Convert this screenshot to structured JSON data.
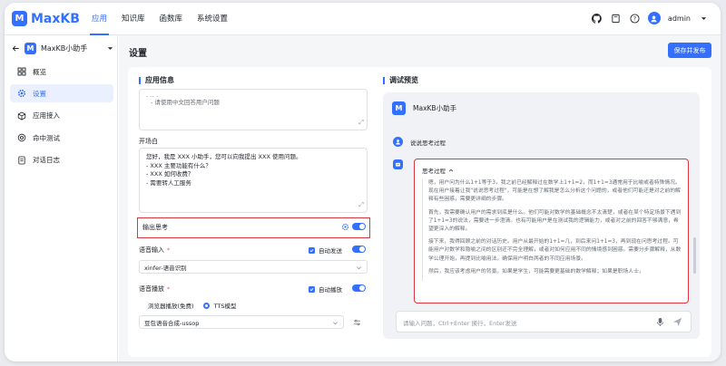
{
  "app": {
    "logo_mark": "M",
    "logo_text": "MaxKB"
  },
  "nav": [
    {
      "label": "应用",
      "active": true
    },
    {
      "label": "知识库",
      "active": false
    },
    {
      "label": "函数库",
      "active": false
    },
    {
      "label": "系统设置",
      "active": false
    }
  ],
  "user": {
    "name": "admin"
  },
  "sidebar": {
    "app_badge": "M",
    "app_name": "MaxKB小助手",
    "items": [
      {
        "label": "概览",
        "icon": "grid-icon",
        "active": false
      },
      {
        "label": "设置",
        "icon": "gear-icon",
        "active": true
      },
      {
        "label": "应用接入",
        "icon": "cube-icon",
        "active": false
      },
      {
        "label": "命中测试",
        "icon": "target-icon",
        "active": false
      },
      {
        "label": "对话日志",
        "icon": "document-icon",
        "active": false
      }
    ]
  },
  "header": {
    "title": "设置",
    "publish_label": "保存并发布"
  },
  "app_info": {
    "section_title": "应用信息",
    "prompt_line_top": "- -- -",
    "prompt_line": "- 请使用中文回答用户问题",
    "opening_label": "开场白",
    "opening_lines": [
      "您好，我是 XXX 小助手，您可以向我提出 XXX 使用问题。",
      "- XXX 主要功能有什么？",
      "- XXX 如何收费？",
      "- 需要转人工服务"
    ],
    "output_thinking_label": "输出思考",
    "voice_input_label": "语音输入",
    "voice_input_auto": "自动发送",
    "voice_input_model": "xinfer-语音识别",
    "voice_play_label": "语音播放",
    "voice_play_auto": "自动播放",
    "tts_browser": "浏览器播放(免费)",
    "tts_model": "TTS模型",
    "tts_model_value": "豆包语音合成-ussop"
  },
  "preview": {
    "section_title": "调试预览",
    "bot_badge": "M",
    "bot_name": "MaxKB小助手",
    "user_message": "说说思考过程",
    "thinking_title": "思考过程",
    "thinking_paragraphs": [
      "嗯，用户问为什么1+1等于3，我之前已经解释过在数学上1+1=2，而1+1=3通常用于比喻或者特殊情况。现在用户接着让我\"说说思考过程\"，可能是在想了解我是怎么分析这个问题的，或者他们可能还是对之前的解释有些困惑，需要更详细的步骤。",
      "首先，我需要确认用户的需求到底是什么。他们可能对数学的基础概念不太清楚，或者在某个特定场景下遇到了1+1=3的说法，需要进一步澄清。也有可能用户是在测试我的逻辑能力，或者对之前的回答不够满意，希望更深入的解释。",
      "接下来，我得回顾之前的对话历史。用户从最开始的1+1=几，到后来问1+1=3，再到现在问思考过程。可能用户对数学和隐喻之间的区别还不完全理解，或者对如何应用不同的情境感到困惑。需要分步骤解释，从数学公理开始，再提到比喻用法，确保用户明白两者的不同应用场景。",
      "然后，我应该考虑用户的背景。如果是学生，可能需要更基础的数学解释；如果是职场人士，"
    ],
    "input_placeholder": "请输入问题，Ctrl+Enter 换行，Enter发送"
  },
  "colors": {
    "accent": "#3370ff",
    "highlight_box": "#d9363e"
  }
}
